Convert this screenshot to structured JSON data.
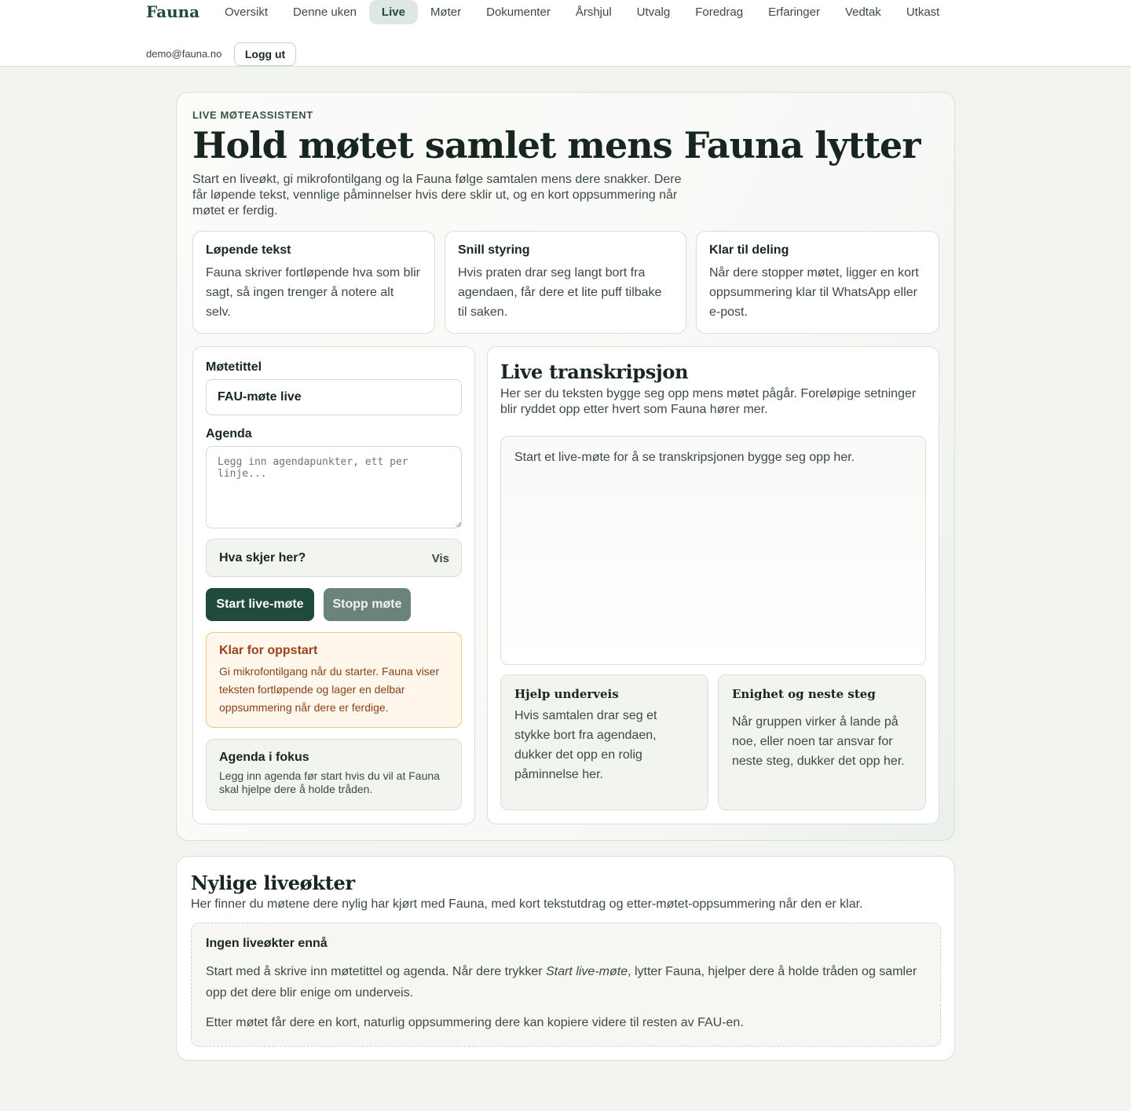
{
  "nav": {
    "brand": "Fauna",
    "items": [
      {
        "label": "Oversikt",
        "active": false
      },
      {
        "label": "Denne uken",
        "active": false
      },
      {
        "label": "Live",
        "active": true
      },
      {
        "label": "Møter",
        "active": false
      },
      {
        "label": "Dokumenter",
        "active": false
      },
      {
        "label": "Årshjul",
        "active": false
      },
      {
        "label": "Utvalg",
        "active": false
      },
      {
        "label": "Foredrag",
        "active": false
      },
      {
        "label": "Erfaringer",
        "active": false
      },
      {
        "label": "Vedtak",
        "active": false
      },
      {
        "label": "Utkast",
        "active": false
      }
    ],
    "user_email": "demo@fauna.no",
    "logout_label": "Logg ut"
  },
  "hero": {
    "eyebrow": "LIVE MØTEASSISTENT",
    "title": "Hold møtet samlet mens Fauna lytter",
    "description": "Start en liveøkt, gi mikrofontilgang og la Fauna følge samtalen mens dere snakker. Dere får løpende tekst, vennlige påminnelser hvis dere sklir ut, og en kort oppsummering når møtet er ferdig."
  },
  "features": [
    {
      "title": "Løpende tekst",
      "text": "Fauna skriver fortløpende hva som blir sagt, så ingen trenger å notere alt selv."
    },
    {
      "title": "Snill styring",
      "text": "Hvis praten drar seg langt bort fra agendaen, får dere et lite puff tilbake til saken."
    },
    {
      "title": "Klar til deling",
      "text": "Når dere stopper møtet, ligger en kort oppsummering klar til WhatsApp eller e-post."
    }
  ],
  "form": {
    "title_label": "Møtetittel",
    "title_value": "FAU-møte live",
    "agenda_label": "Agenda",
    "agenda_placeholder": "Legg inn agendapunkter, ett per linje...",
    "help_question": "Hva skjer her?",
    "help_toggle": "Vis",
    "start_button": "Start live-møte",
    "stop_button": "Stopp møte",
    "status_title": "Klar for oppstart",
    "status_text": "Gi mikrofontilgang når du starter. Fauna viser teksten fortløpende og lager en delbar oppsummering når dere er ferdige.",
    "focus_title": "Agenda i fokus",
    "focus_text": "Legg inn agenda før start hvis du vil at Fauna skal hjelpe dere å holde tråden."
  },
  "transcript": {
    "title": "Live transkripsjon",
    "description": "Her ser du teksten bygge seg opp mens møtet pågår. Foreløpige setninger blir ryddet opp etter hvert som Fauna hører mer.",
    "placeholder": "Start et live-møte for å se transkripsjonen bygge seg opp her.",
    "tips": [
      {
        "title": "Hjelp underveis",
        "text": "Hvis samtalen drar seg et stykke bort fra agendaen, dukker det opp en rolig påminnelse her."
      },
      {
        "title": "Enighet og neste steg",
        "text": "Når gruppen virker å lande på noe, eller noen tar ansvar for neste steg, dukker det opp her."
      }
    ]
  },
  "recent": {
    "title": "Nylige liveøkter",
    "description": "Her finner du møtene dere nylig har kjørt med Fauna, med kort tekstutdrag og etter-møtet-oppsummering når den er klar.",
    "empty_title": "Ingen liveøkter ennå",
    "empty_p1_before": "Start med å skrive inn møtetittel og agenda. Når dere trykker ",
    "empty_p1_em": "Start live-møte",
    "empty_p1_after": ", lytter Fauna, hjelper dere å holde tråden og samler opp det dere blir enige om underveis.",
    "empty_p2": "Etter møtet får dere en kort, naturlig oppsummering dere kan kopiere videre til resten av FAU-en."
  },
  "colors": {
    "accent": "#1f4a3c",
    "page_bg": "#f2f4f0",
    "status_bg": "#fff7ec",
    "status_border": "#eecb7e",
    "status_text": "#9a4418"
  }
}
